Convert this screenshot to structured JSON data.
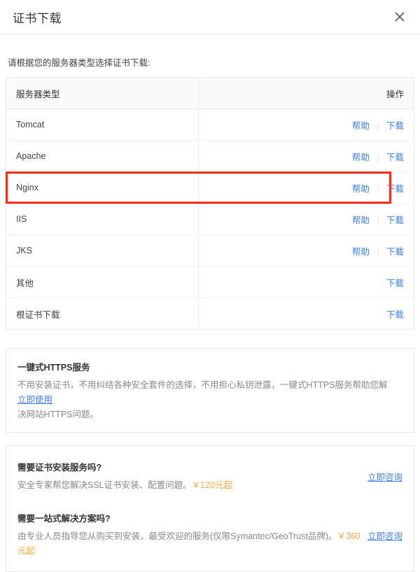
{
  "modal": {
    "title": "证书下载",
    "close_icon": "close-icon"
  },
  "intro": "请根据您的服务器类型选择证书下载:",
  "table": {
    "headers": {
      "type": "服务器类型",
      "action": "操作"
    },
    "labels": {
      "help": "帮助",
      "download": "下载",
      "separator": "|"
    },
    "rows": [
      {
        "type": "Tomcat",
        "help": "帮助",
        "download": "下载",
        "has_help": true,
        "highlighted": false
      },
      {
        "type": "Apache",
        "help": "帮助",
        "download": "下载",
        "has_help": true,
        "highlighted": false
      },
      {
        "type": "Nginx",
        "help": "帮助",
        "download": "下载",
        "has_help": true,
        "highlighted": true
      },
      {
        "type": "IIS",
        "help": "帮助",
        "download": "下载",
        "has_help": true,
        "highlighted": false
      },
      {
        "type": "JKS",
        "help": "帮助",
        "download": "下载",
        "has_help": true,
        "highlighted": false
      },
      {
        "type": "其他",
        "download": "下载",
        "has_help": false,
        "highlighted": false
      },
      {
        "type": "根证书下载",
        "download": "下载",
        "has_help": false,
        "highlighted": false
      }
    ]
  },
  "promo_https": {
    "title": "一键式HTTPS服务",
    "desc_before": "不用安装证书，不用纠结各种安全套件的选择，不用担心私钥泄露，一键式HTTPS服务帮助您解",
    "desc_after": "决网站HTTPS问题。",
    "link": "立即使用"
  },
  "promo_services": [
    {
      "title": "需要证书安装服务吗?",
      "desc": "安全专家帮您解决SSL证书安装、配置问题。",
      "price": "￥120元起",
      "link": "立即咨询"
    },
    {
      "title": "需要一站式解决方案吗?",
      "desc": "由专业人员指导您从购买到安装，最受欢迎的服务(仅限Symantec/GeoTrust品牌)。",
      "price": "￥360元起",
      "link": "立即咨询"
    }
  ],
  "colors": {
    "link": "#3d7ef0",
    "price": "#f7a93b",
    "highlight_border": "#f92c1c",
    "header_bg": "#fafafa",
    "border": "#e9e9e9"
  }
}
